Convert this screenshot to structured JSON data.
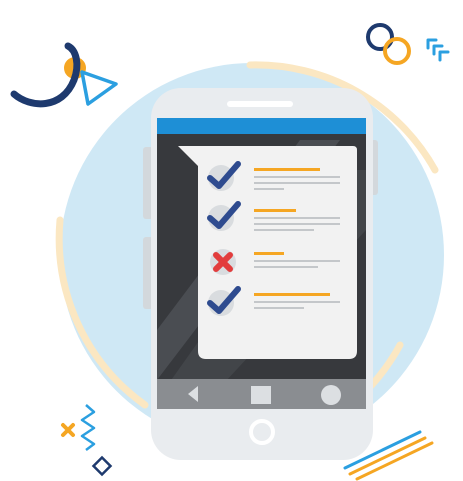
{
  "illustration": {
    "colors": {
      "background": "#ffffff",
      "circle_bg": "#cfe8f5",
      "arc_cream": "#fbe7c2",
      "phone_body": "#e9ecef",
      "phone_shadow": "#d3d8dc",
      "screen": "#37393d",
      "screen_stripe": "#4a4d52",
      "status_bar": "#1e8fd6",
      "nav_bar": "#8a8d91",
      "nav_icon": "#dcdfe2",
      "card": "#f2f2f2",
      "check_circle": "#d9dcdf",
      "check_mark": "#2e4b8f",
      "cross_mark": "#e23d3d",
      "line_orange": "#f5a623",
      "line_gray": "#c4c7ca",
      "navy": "#1e3a6e",
      "orange": "#f5a623",
      "sky": "#2b9fe0"
    },
    "checklist": [
      {
        "status": "checked",
        "icon": "check-icon"
      },
      {
        "status": "checked",
        "icon": "check-icon"
      },
      {
        "status": "rejected",
        "icon": "cross-icon"
      },
      {
        "status": "checked",
        "icon": "check-icon"
      }
    ],
    "nav_buttons": [
      "back-icon",
      "home-icon",
      "recent-icon"
    ]
  }
}
